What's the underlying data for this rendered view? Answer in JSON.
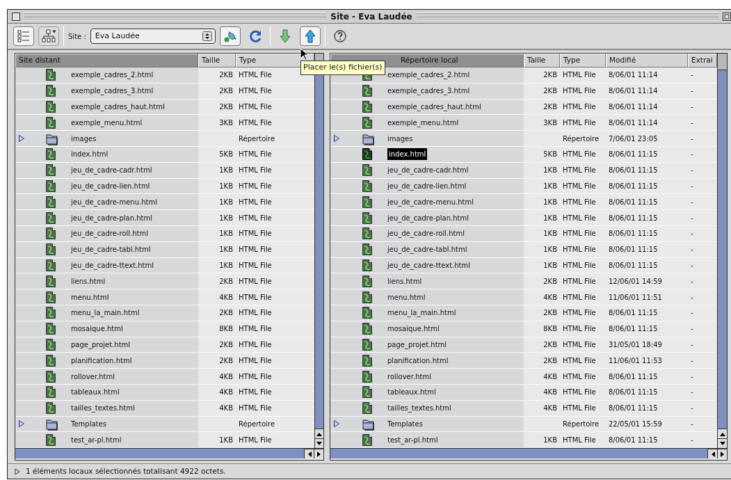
{
  "window": {
    "title": "Site - Eva Laudée"
  },
  "toolbar": {
    "views": [
      {
        "kind": "list",
        "selected": true
      },
      {
        "kind": "map",
        "selected": false
      }
    ],
    "site_label": "Site :",
    "site_value": "Eva Laudée",
    "actions": [
      {
        "kind": "connect",
        "pressed": true
      },
      {
        "kind": "refresh",
        "pressed": false
      },
      {
        "kind": "get",
        "pressed": false
      },
      {
        "kind": "put",
        "pressed": true
      },
      {
        "kind": "help",
        "pressed": false
      }
    ],
    "tooltip": "Placer le(s) fichier(s)"
  },
  "remote": {
    "columns": [
      {
        "label": "Site distant",
        "sorted": true
      },
      {
        "label": "Taille",
        "sorted": false
      },
      {
        "label": "Type",
        "sorted": false
      }
    ],
    "rows": [
      {
        "kind": "file",
        "name": "exemple_cadres_2.html",
        "size": "2KB",
        "type": "HTML File",
        "selected": false
      },
      {
        "kind": "file",
        "name": "exemple_cadres_3.html",
        "size": "2KB",
        "type": "HTML File",
        "selected": false
      },
      {
        "kind": "file",
        "name": "exemple_cadres_haut.html",
        "size": "2KB",
        "type": "HTML File",
        "selected": false
      },
      {
        "kind": "file",
        "name": "exemple_menu.html",
        "size": "3KB",
        "type": "HTML File",
        "selected": false
      },
      {
        "kind": "folder",
        "name": "images",
        "size": "",
        "type": "Répertoire",
        "selected": false
      },
      {
        "kind": "file",
        "name": "index.html",
        "size": "5KB",
        "type": "HTML File",
        "selected": false
      },
      {
        "kind": "file",
        "name": "jeu_de_cadre-cadr.html",
        "size": "1KB",
        "type": "HTML File",
        "selected": false
      },
      {
        "kind": "file",
        "name": "jeu_de_cadre-lien.html",
        "size": "1KB",
        "type": "HTML File",
        "selected": false
      },
      {
        "kind": "file",
        "name": "jeu_de_cadre-menu.html",
        "size": "1KB",
        "type": "HTML File",
        "selected": false
      },
      {
        "kind": "file",
        "name": "jeu_de_cadre-plan.html",
        "size": "1KB",
        "type": "HTML File",
        "selected": false
      },
      {
        "kind": "file",
        "name": "jeu_de_cadre-roll.html",
        "size": "1KB",
        "type": "HTML File",
        "selected": false
      },
      {
        "kind": "file",
        "name": "jeu_de_cadre-tabl.html",
        "size": "1KB",
        "type": "HTML File",
        "selected": false
      },
      {
        "kind": "file",
        "name": "jeu_de_cadre-ttext.html",
        "size": "1KB",
        "type": "HTML File",
        "selected": false
      },
      {
        "kind": "file",
        "name": "liens.html",
        "size": "2KB",
        "type": "HTML File",
        "selected": false
      },
      {
        "kind": "file",
        "name": "menu.html",
        "size": "4KB",
        "type": "HTML File",
        "selected": false
      },
      {
        "kind": "file",
        "name": "menu_la_main.html",
        "size": "2KB",
        "type": "HTML File",
        "selected": false
      },
      {
        "kind": "file",
        "name": "mosaique.html",
        "size": "8KB",
        "type": "HTML File",
        "selected": false
      },
      {
        "kind": "file",
        "name": "page_projet.html",
        "size": "2KB",
        "type": "HTML File",
        "selected": false
      },
      {
        "kind": "file",
        "name": "planification.html",
        "size": "2KB",
        "type": "HTML File",
        "selected": false
      },
      {
        "kind": "file",
        "name": "rollover.html",
        "size": "4KB",
        "type": "HTML File",
        "selected": false
      },
      {
        "kind": "file",
        "name": "tableaux.html",
        "size": "4KB",
        "type": "HTML File",
        "selected": false
      },
      {
        "kind": "file",
        "name": "tailles_textes.html",
        "size": "4KB",
        "type": "HTML File",
        "selected": false
      },
      {
        "kind": "folder",
        "name": "Templates",
        "size": "",
        "type": "Répertoire",
        "selected": false
      },
      {
        "kind": "file",
        "name": "test_ar-pl.html",
        "size": "1KB",
        "type": "HTML File",
        "selected": false
      }
    ]
  },
  "local": {
    "columns": [
      {
        "label": "Répertoire local",
        "sorted": true
      },
      {
        "label": "Taille",
        "sorted": false
      },
      {
        "label": "Type",
        "sorted": false
      },
      {
        "label": "Modifié",
        "sorted": false
      },
      {
        "label": "Extrai",
        "sorted": false
      }
    ],
    "rows": [
      {
        "kind": "file",
        "name": "exemple_cadres_2.html",
        "size": "2KB",
        "type": "HTML File",
        "modified": "8/06/01 11:14",
        "extract": "-",
        "selected": false
      },
      {
        "kind": "file",
        "name": "exemple_cadres_3.html",
        "size": "2KB",
        "type": "HTML File",
        "modified": "8/06/01 11:14",
        "extract": "-",
        "selected": false
      },
      {
        "kind": "file",
        "name": "exemple_cadres_haut.html",
        "size": "2KB",
        "type": "HTML File",
        "modified": "8/06/01 11:14",
        "extract": "-",
        "selected": false
      },
      {
        "kind": "file",
        "name": "exemple_menu.html",
        "size": "3KB",
        "type": "HTML File",
        "modified": "8/06/01 11:14",
        "extract": "-",
        "selected": false
      },
      {
        "kind": "folder",
        "name": "images",
        "size": "",
        "type": "Répertoire",
        "modified": "7/06/01 23:05",
        "extract": "-",
        "selected": false
      },
      {
        "kind": "file",
        "name": "index.html",
        "size": "5KB",
        "type": "HTML File",
        "modified": "8/06/01 11:15",
        "extract": "-",
        "selected": true
      },
      {
        "kind": "file",
        "name": "jeu_de_cadre-cadr.html",
        "size": "1KB",
        "type": "HTML File",
        "modified": "8/06/01 11:15",
        "extract": "-",
        "selected": false
      },
      {
        "kind": "file",
        "name": "jeu_de_cadre-lien.html",
        "size": "1KB",
        "type": "HTML File",
        "modified": "8/06/01 11:15",
        "extract": "-",
        "selected": false
      },
      {
        "kind": "file",
        "name": "jeu_de_cadre-menu.html",
        "size": "1KB",
        "type": "HTML File",
        "modified": "8/06/01 11:15",
        "extract": "-",
        "selected": false
      },
      {
        "kind": "file",
        "name": "jeu_de_cadre-plan.html",
        "size": "1KB",
        "type": "HTML File",
        "modified": "8/06/01 11:15",
        "extract": "-",
        "selected": false
      },
      {
        "kind": "file",
        "name": "jeu_de_cadre-roll.html",
        "size": "1KB",
        "type": "HTML File",
        "modified": "8/06/01 11:15",
        "extract": "-",
        "selected": false
      },
      {
        "kind": "file",
        "name": "jeu_de_cadre-tabl.html",
        "size": "1KB",
        "type": "HTML File",
        "modified": "8/06/01 11:15",
        "extract": "-",
        "selected": false
      },
      {
        "kind": "file",
        "name": "jeu_de_cadre-ttext.html",
        "size": "1KB",
        "type": "HTML File",
        "modified": "8/06/01 11:15",
        "extract": "-",
        "selected": false
      },
      {
        "kind": "file",
        "name": "liens.html",
        "size": "2KB",
        "type": "HTML File",
        "modified": "12/06/01 14:59",
        "extract": "-",
        "selected": false
      },
      {
        "kind": "file",
        "name": "menu.html",
        "size": "4KB",
        "type": "HTML File",
        "modified": "11/06/01 11:51",
        "extract": "-",
        "selected": false
      },
      {
        "kind": "file",
        "name": "menu_la_main.html",
        "size": "2KB",
        "type": "HTML File",
        "modified": "8/06/01 11:15",
        "extract": "-",
        "selected": false
      },
      {
        "kind": "file",
        "name": "mosaique.html",
        "size": "8KB",
        "type": "HTML File",
        "modified": "8/06/01 11:15",
        "extract": "-",
        "selected": false
      },
      {
        "kind": "file",
        "name": "page_projet.html",
        "size": "2KB",
        "type": "HTML File",
        "modified": "31/05/01 18:49",
        "extract": "-",
        "selected": false
      },
      {
        "kind": "file",
        "name": "planification.html",
        "size": "2KB",
        "type": "HTML File",
        "modified": "11/06/01 11:53",
        "extract": "-",
        "selected": false
      },
      {
        "kind": "file",
        "name": "rollover.html",
        "size": "4KB",
        "type": "HTML File",
        "modified": "8/06/01 11:15",
        "extract": "-",
        "selected": false
      },
      {
        "kind": "file",
        "name": "tableaux.html",
        "size": "4KB",
        "type": "HTML File",
        "modified": "8/06/01 11:15",
        "extract": "-",
        "selected": false
      },
      {
        "kind": "file",
        "name": "tailles_textes.html",
        "size": "4KB",
        "type": "HTML File",
        "modified": "8/06/01 11:15",
        "extract": "-",
        "selected": false
      },
      {
        "kind": "folder",
        "name": "Templates",
        "size": "",
        "type": "Répertoire",
        "modified": "22/05/01 15:59",
        "extract": "-",
        "selected": false
      },
      {
        "kind": "file",
        "name": "test_ar-pl.html",
        "size": "1KB",
        "type": "HTML File",
        "modified": "8/06/01 11:15",
        "extract": "-",
        "selected": false
      }
    ]
  },
  "status_bar": {
    "text": "1 éléments locaux sélectionnés totalisant 4922 octets."
  }
}
